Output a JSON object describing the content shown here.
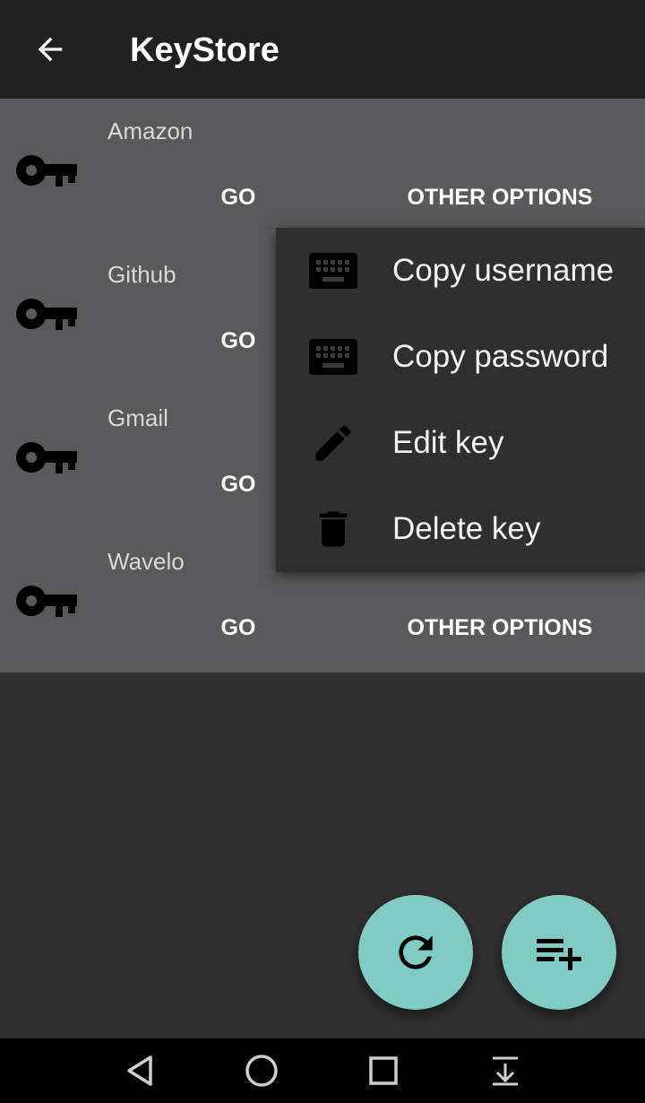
{
  "app_bar": {
    "title": "KeyStore",
    "back_icon": "arrow-back-icon"
  },
  "entries": [
    {
      "name": "Amazon",
      "go_label": "GO",
      "options_label": "OTHER OPTIONS"
    },
    {
      "name": "Github",
      "go_label": "GO",
      "options_label": ""
    },
    {
      "name": "Gmail",
      "go_label": "GO",
      "options_label": ""
    },
    {
      "name": "Wavelo",
      "go_label": "GO",
      "options_label": "OTHER OPTIONS"
    }
  ],
  "options_menu": {
    "items": [
      {
        "label": "Copy username",
        "icon": "keyboard-icon"
      },
      {
        "label": "Copy password",
        "icon": "keyboard-icon"
      },
      {
        "label": "Edit key",
        "icon": "pencil-icon"
      },
      {
        "label": "Delete key",
        "icon": "trash-icon"
      }
    ]
  },
  "fabs": {
    "refresh_icon": "refresh-icon",
    "add_icon": "playlist-add-icon"
  },
  "nav_bar": {
    "icons": [
      "back-triangle-icon",
      "home-circle-icon",
      "recents-square-icon",
      "notifications-down-icon"
    ]
  },
  "colors": {
    "app_bar": "#212121",
    "list_background": "#5a5a5c",
    "menu_background": "#2f2f2f",
    "page_background": "#303030",
    "fab": "#80cbc4"
  }
}
